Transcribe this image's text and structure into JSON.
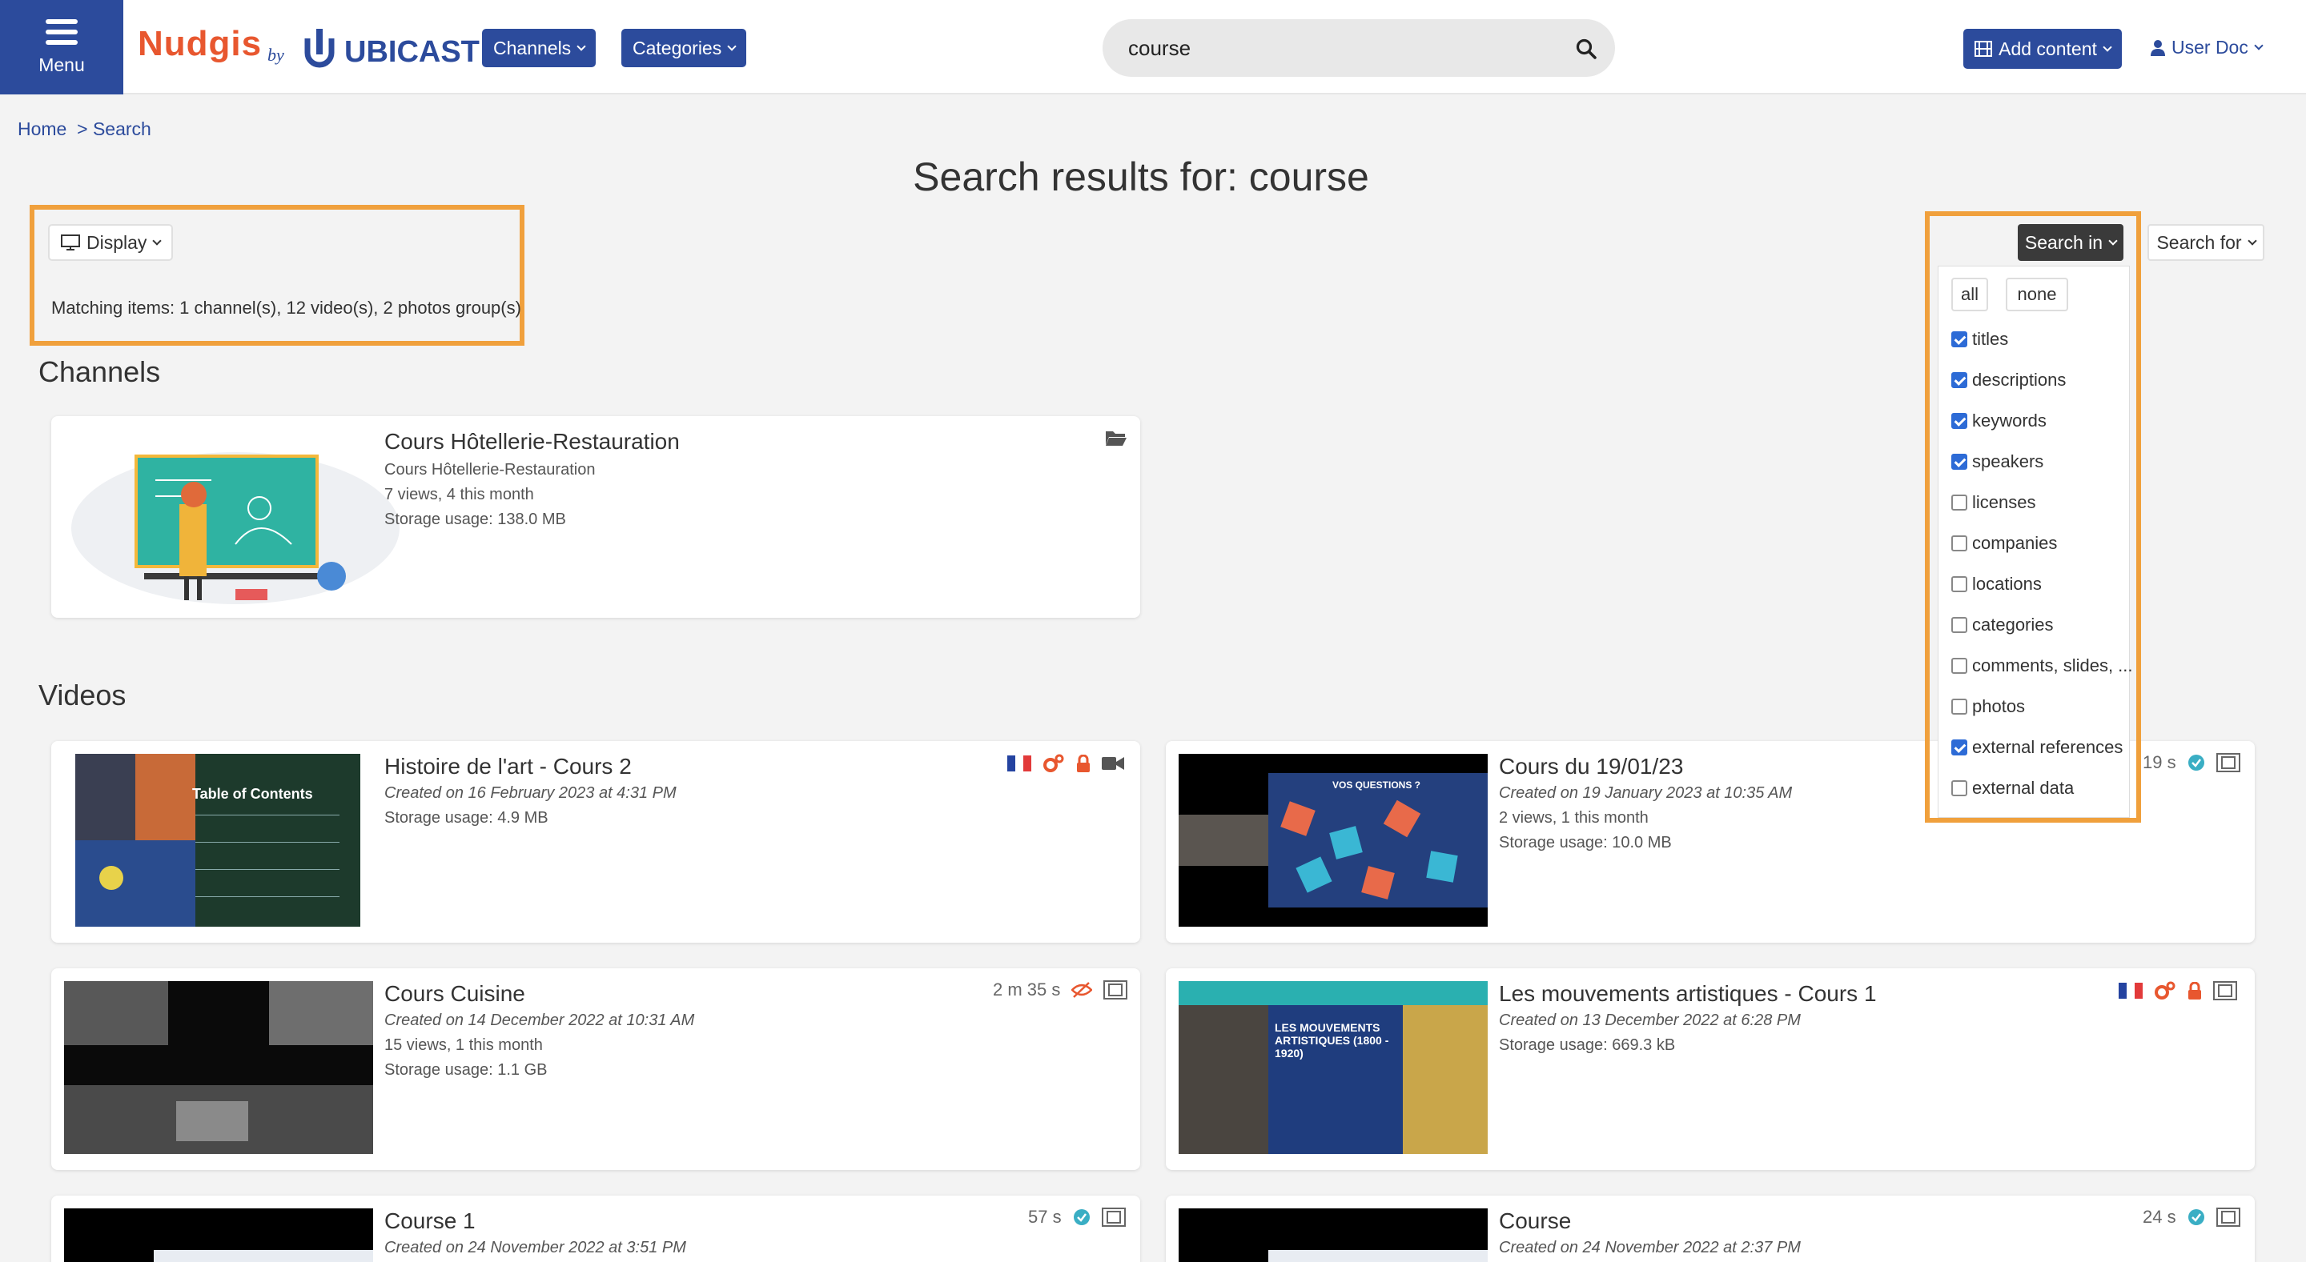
{
  "header": {
    "menu_label": "Menu",
    "logo_nudgis": "Nudgis",
    "logo_by": "by",
    "logo_ubicast": "UBICAST",
    "channels_label": "Channels",
    "categories_label": "Categories",
    "search_value": "course",
    "add_content_label": "Add content",
    "user_label": "User Doc"
  },
  "breadcrumb": {
    "home": "Home",
    "sep": ">",
    "current": "Search"
  },
  "page_title": "Search results for: course",
  "display_label": "Display",
  "matching_text": "Matching items: 1 channel(s), 12 video(s), 2 photos group(s)",
  "channels": {
    "heading": "Channels",
    "items": [
      {
        "title": "Cours Hôtellerie-Restauration",
        "subtitle": "Cours Hôtellerie-Restauration",
        "views": "7 views, 4 this month",
        "storage": "Storage usage: 138.0 MB"
      }
    ]
  },
  "videos": {
    "heading": "Videos",
    "items": [
      {
        "title": "Histoire de l'art - Cours 2",
        "created": "Created on 16 February 2023 at 4:31 PM",
        "line2": "Storage usage: 4.9 MB",
        "line3": "",
        "duration": "",
        "thumb_text": "Table of Contents"
      },
      {
        "title": "Cours du 19/01/23",
        "created": "Created on 19 January 2023 at 10:35 AM",
        "line2": "2 views, 1 this month",
        "line3": "Storage usage: 10.0 MB",
        "duration": "19 s",
        "thumb_text": "VOS QUESTIONS ?"
      },
      {
        "title": "Cours Cuisine",
        "created": "Created on 14 December 2022 at 10:31 AM",
        "line2": "15 views, 1 this month",
        "line3": "Storage usage: 1.1 GB",
        "duration": "2 m 35 s",
        "thumb_text": ""
      },
      {
        "title": "Les mouvements artistiques - Cours 1",
        "created": "Created on 13 December 2022 at 6:28 PM",
        "line2": "Storage usage: 669.3 kB",
        "line3": "",
        "duration": "",
        "thumb_text": "LES MOUVEMENTS ARTISTIQUES (1800 - 1920)"
      },
      {
        "title": "Course 1",
        "created": "Created on 24 November 2022 at 3:51 PM",
        "line2": "",
        "line3": "",
        "duration": "57 s",
        "thumb_text": ""
      },
      {
        "title": "Course",
        "created": "Created on 24 November 2022 at 2:37 PM",
        "line2": "",
        "line3": "",
        "duration": "24 s",
        "thumb_text": ""
      }
    ]
  },
  "search_in": {
    "label": "Search in",
    "all": "all",
    "none": "none",
    "options": [
      {
        "label": "titles",
        "checked": true
      },
      {
        "label": "descriptions",
        "checked": true
      },
      {
        "label": "keywords",
        "checked": true
      },
      {
        "label": "speakers",
        "checked": true
      },
      {
        "label": "licenses",
        "checked": false
      },
      {
        "label": "companies",
        "checked": false
      },
      {
        "label": "locations",
        "checked": false
      },
      {
        "label": "categories",
        "checked": false
      },
      {
        "label": "comments, slides, ...",
        "checked": false
      },
      {
        "label": "photos",
        "checked": false
      },
      {
        "label": "external references",
        "checked": true
      },
      {
        "label": "external data",
        "checked": false
      }
    ]
  },
  "search_for_label": "Search for",
  "colors": {
    "brand_blue": "#2c4b9c",
    "accent_orange": "#e8572f",
    "highlight": "#f0a03c",
    "check_green": "#3aaec4"
  }
}
